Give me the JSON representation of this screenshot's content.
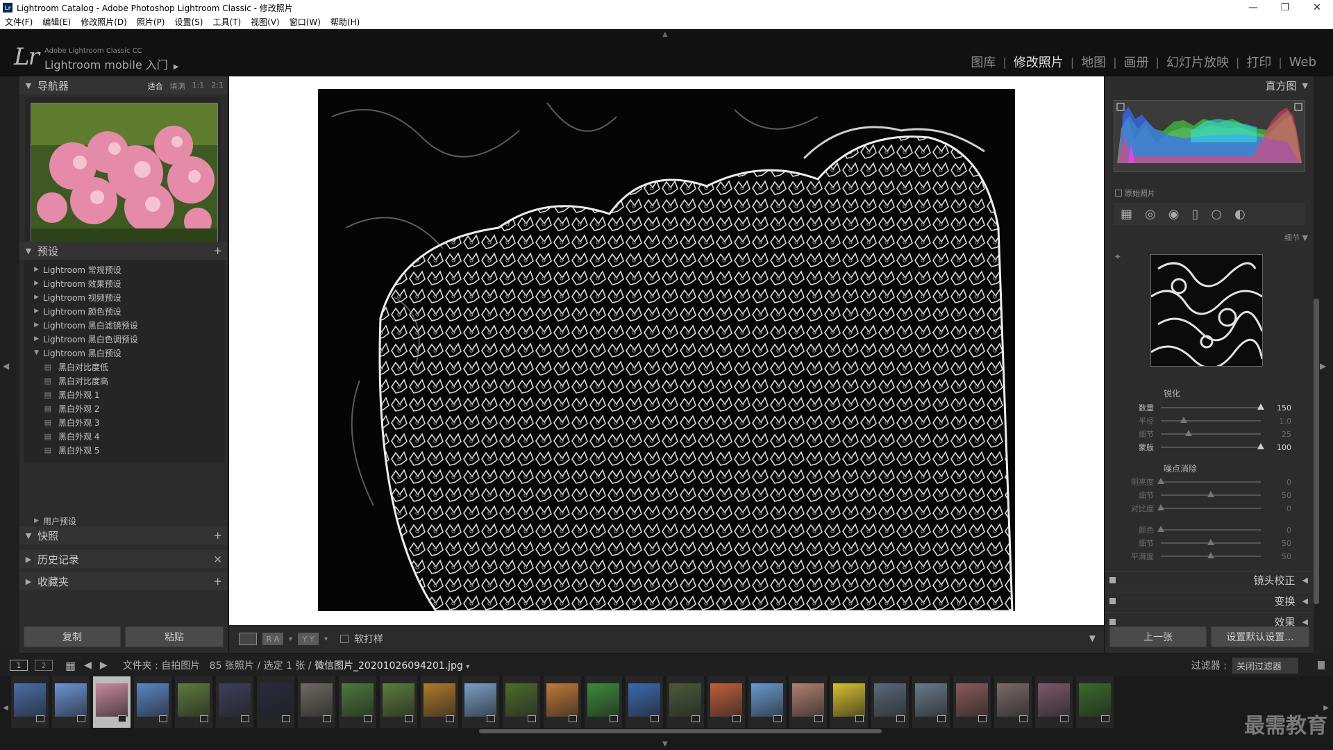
{
  "titlebar": {
    "title": "Lightroom Catalog - Adobe Photoshop Lightroom Classic - 修改照片",
    "app_icon": "Lr",
    "minimize": "—",
    "restore": "❐",
    "close": "✕"
  },
  "menu": [
    "文件(F)",
    "编辑(E)",
    "修改照片(D)",
    "照片(P)",
    "设置(S)",
    "工具(T)",
    "视图(V)",
    "窗口(W)",
    "帮助(H)"
  ],
  "identity": {
    "logo": "Lr",
    "small": "Adobe Lightroom Classic CC",
    "main": "Lightroom mobile 入门",
    "caret": "▶"
  },
  "modules": [
    {
      "label": "图库",
      "active": false
    },
    {
      "label": "修改照片",
      "active": true
    },
    {
      "label": "地图",
      "active": false
    },
    {
      "label": "画册",
      "active": false
    },
    {
      "label": "幻灯片放映",
      "active": false
    },
    {
      "label": "打印",
      "active": false
    },
    {
      "label": "Web",
      "active": false
    }
  ],
  "navigator": {
    "title": "导航器",
    "options": [
      "适合",
      "填满",
      "1:1",
      "2:1"
    ],
    "active_option": "适合"
  },
  "presets": {
    "title": "预设",
    "add": "+",
    "groups": [
      "Lightroom 常规预设",
      "Lightroom 效果预设",
      "Lightroom 视频预设",
      "Lightroom 颜色预设",
      "Lightroom 黑白滤镜预设",
      "Lightroom 黑白色调预设",
      "Lightroom 黑白预设"
    ],
    "children": [
      "黑白对比度低",
      "黑白对比度高",
      "黑白外观 1",
      "黑白外观 2",
      "黑白外观 3",
      "黑白外观 4",
      "黑白外观 5"
    ],
    "user": "用户预设"
  },
  "snapshots": {
    "title": "快照",
    "action": "+"
  },
  "history": {
    "title": "历史记录",
    "action": "×"
  },
  "collections": {
    "title": "收藏夹",
    "action": "+"
  },
  "left_buttons": {
    "copy": "复制",
    "paste": "粘贴"
  },
  "toolbar": {
    "view_ra": "R A",
    "view_yy": "Y Y",
    "softproof": "软打样"
  },
  "histogram": {
    "title": "直方图",
    "original": "原始照片"
  },
  "detail": {
    "title": "细节",
    "sharpen_title": "锐化",
    "sharpen": [
      {
        "label": "数量",
        "value": "150",
        "pos": 1.0,
        "dim": false
      },
      {
        "label": "半径",
        "value": "1.0",
        "pos": 0.23,
        "dim": true
      },
      {
        "label": "细节",
        "value": "25",
        "pos": 0.28,
        "dim": true
      },
      {
        "label": "蒙版",
        "value": "100",
        "pos": 1.0,
        "dim": false
      }
    ],
    "noise_title": "噪点消除",
    "noise": [
      {
        "label": "明亮度",
        "value": "0",
        "pos": 0.0,
        "dim": true
      },
      {
        "label": "细节",
        "value": "50",
        "pos": 0.5,
        "dim": true
      },
      {
        "label": "对比度",
        "value": "0",
        "pos": 0.0,
        "dim": true
      },
      {
        "label": "颜色",
        "value": "0",
        "pos": 0.0,
        "dim": true
      },
      {
        "label": "细节",
        "value": "50",
        "pos": 0.5,
        "dim": true
      },
      {
        "label": "平滑度",
        "value": "50",
        "pos": 0.5,
        "dim": true
      }
    ]
  },
  "panels": {
    "lens": "镜头校正",
    "transform": "变换",
    "effects": "效果"
  },
  "right_buttons": {
    "prev": "上一张",
    "reset": "设置默认设置..."
  },
  "filmbar": {
    "mon1": "1",
    "mon2": "2",
    "folder_label": "文件夹 : 自拍图片",
    "count": "85 张照片 / 选定 1 张 /",
    "filename": "微信图片_20201026094201.jpg",
    "filter_label": "过滤器 :",
    "filter_value": "关闭过滤器"
  },
  "watermark": "最需教育",
  "colors": {
    "accent_flower": "#e58aa8",
    "panel_bg": "#2c2c2c"
  }
}
